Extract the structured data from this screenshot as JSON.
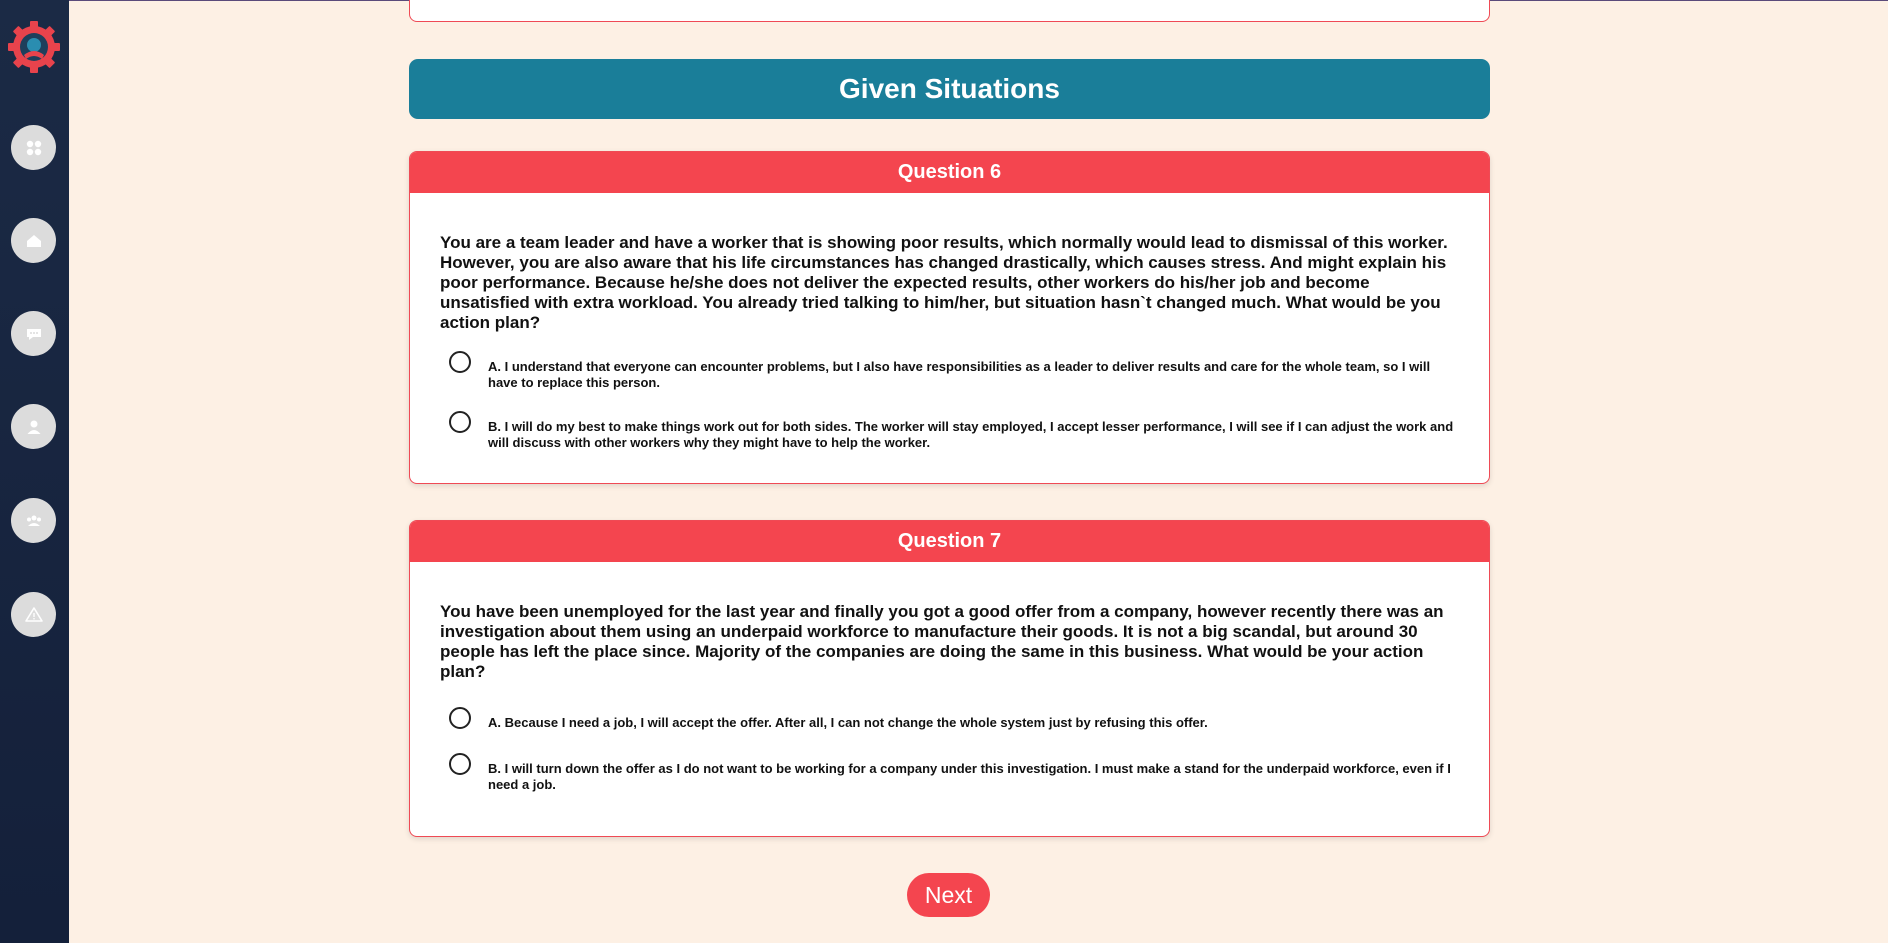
{
  "section_title": "Given Situations",
  "questions": [
    {
      "header": "Question 6",
      "text": "You are a team leader and have a worker that is showing poor results, which normally would lead to dismissal of this worker. However, you are also aware that his life circumstances has changed drastically, which causes stress. And might explain his poor performance. Because he/she does not deliver the expected results, other workers do his/her job and become unsatisfied with extra workload. You already tried talking to him/her, but situation hasn`t changed much. What would be you action plan?",
      "options": [
        "A. I understand that everyone can encounter problems, but I also have responsibilities as a leader to deliver results and care for the whole team, so I will have to replace this person.",
        "B. I will do my best to make things work out for both sides. The worker will stay employed, I accept lesser performance, I will see if I can adjust the work and will discuss with other workers why they might have to help the worker."
      ]
    },
    {
      "header": "Question 7",
      "text": "You have been unemployed for the last year and finally you got a good offer from a company, however recently there was an investigation about them using an underpaid workforce to manufacture their goods. It is not a big scandal, but around 30 people has left the place since. Majority of the companies are doing the same in this business. What would be your action plan?",
      "options": [
        "A. Because I need a job, I will accept the offer. After all, I can not change the whole system just by refusing this offer.",
        "B. I will turn down the offer as I do not want to be working for a company under this investigation. I must make a stand for the underpaid workforce, even if I need a job."
      ]
    }
  ],
  "next_label": "Next",
  "sidebar": {
    "icons": [
      "dashboard-icon",
      "home-icon",
      "chat-icon",
      "user-icon",
      "team-icon",
      "warning-icon"
    ]
  },
  "colors": {
    "accent": "#f4454f",
    "header_teal": "#1a7e99",
    "background": "#fdf0e4",
    "sidebar": "#1b2a45"
  }
}
